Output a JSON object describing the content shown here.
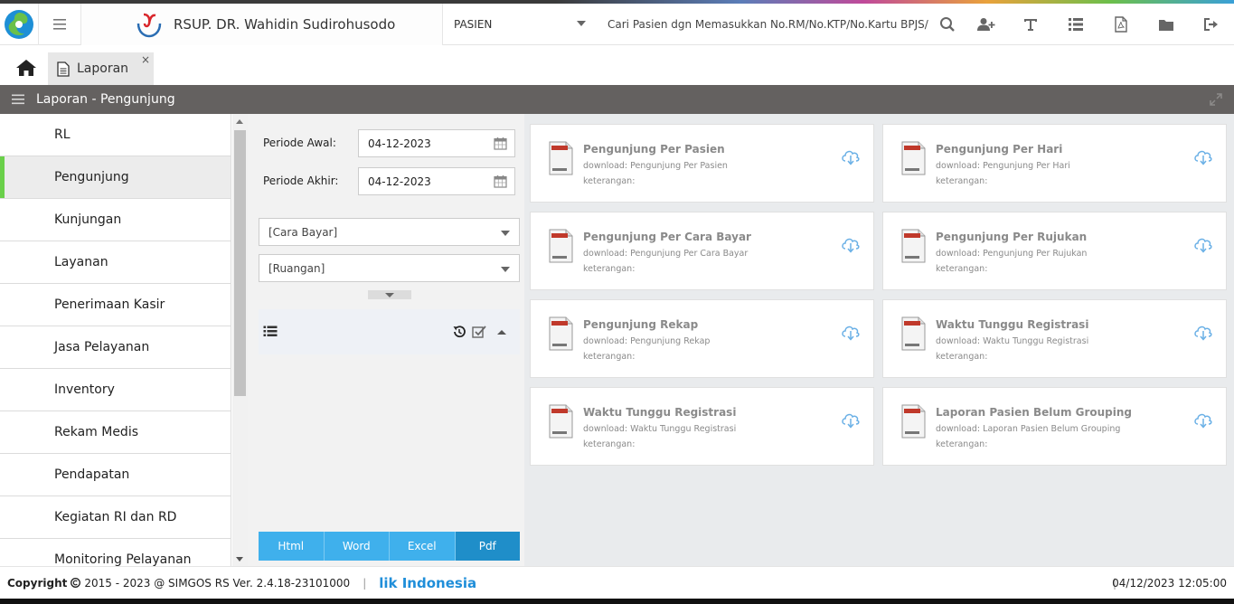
{
  "header": {
    "hospital_name": "RSUP. DR. Wahidin Sudirohusodo",
    "patient_select": "PASIEN",
    "search_placeholder": "Cari Pasien dgn Memasukkan No.RM/No.KTP/No.Kartu BPJS/"
  },
  "tabs": {
    "active_label": "Laporan",
    "close": "×"
  },
  "titlebar": {
    "title": "Laporan - Pengunjung"
  },
  "sidebar": {
    "items": [
      {
        "label": "RL"
      },
      {
        "label": "Pengunjung"
      },
      {
        "label": "Kunjungan"
      },
      {
        "label": "Layanan"
      },
      {
        "label": "Penerimaan Kasir"
      },
      {
        "label": "Jasa Pelayanan"
      },
      {
        "label": "Inventory"
      },
      {
        "label": "Rekam Medis"
      },
      {
        "label": "Pendapatan"
      },
      {
        "label": "Kegiatan RI dan RD"
      },
      {
        "label": "Monitoring Pelayanan"
      }
    ]
  },
  "filter": {
    "periode_awal_label": "Periode Awal:",
    "periode_awal_value": "04-12-2023",
    "periode_akhir_label": "Periode Akhir:",
    "periode_akhir_value": "04-12-2023",
    "cara_bayar": "[Cara Bayar]",
    "ruangan": "[Ruangan]",
    "buttons": [
      "Html",
      "Word",
      "Excel",
      "Pdf"
    ]
  },
  "reports": [
    {
      "title": "Pengunjung Per Pasien",
      "download": "download: Pengunjung Per Pasien",
      "keterangan": "keterangan:"
    },
    {
      "title": "Pengunjung Per Hari",
      "download": "download: Pengunjung Per Hari",
      "keterangan": "keterangan:"
    },
    {
      "title": "Pengunjung Per Cara Bayar",
      "download": "download: Pengunjung Per Cara Bayar",
      "keterangan": "keterangan:"
    },
    {
      "title": "Pengunjung Per Rujukan",
      "download": "download: Pengunjung Per Rujukan",
      "keterangan": "keterangan:"
    },
    {
      "title": "Pengunjung Rekap",
      "download": "download: Pengunjung Rekap",
      "keterangan": "keterangan:"
    },
    {
      "title": "Waktu Tunggu Registrasi",
      "download": "download: Waktu Tunggu Registrasi",
      "keterangan": "keterangan:"
    },
    {
      "title": "Waktu Tunggu Registrasi",
      "download": "download: Waktu Tunggu Registrasi",
      "keterangan": "keterangan:"
    },
    {
      "title": "Laporan Pasien Belum Grouping",
      "download": "download: Laporan Pasien Belum Grouping",
      "keterangan": "keterangan:"
    }
  ],
  "footer": {
    "copyright": "Copyright",
    "version": "2015 - 2023 @ SIMGOS RS Ver. 2.4.18-23101000",
    "brand": "lik Indonesia",
    "clock": "04/12/2023 12:05:00"
  },
  "colors": {
    "accent_green": "#6ad04a",
    "title_bar": "#646160",
    "button_blue": "#3fb0ec",
    "button_active": "#1f8ec9"
  }
}
